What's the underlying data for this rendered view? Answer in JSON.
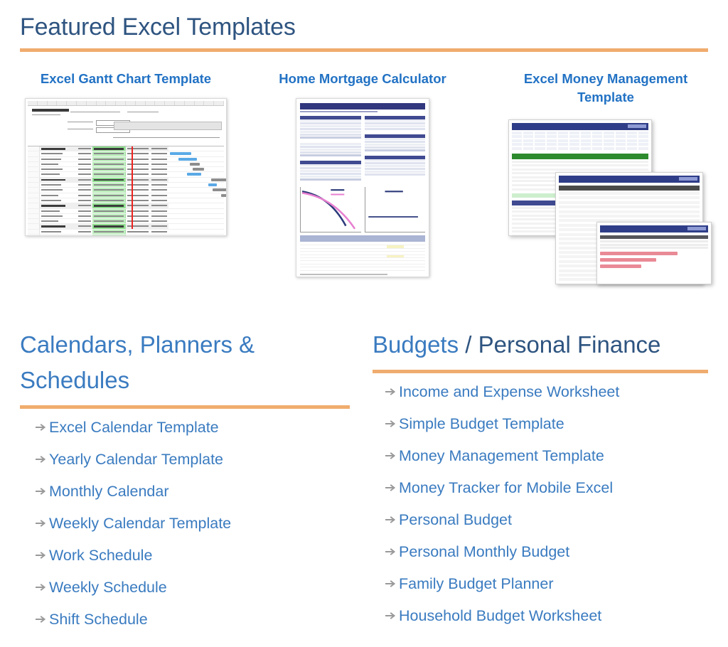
{
  "featured": {
    "title": "Featured Excel Templates",
    "accent_color": "#f0ac6e",
    "title_color": "#2e5480",
    "link_color": "#3a7bc0",
    "cards": [
      {
        "title": "Excel Gantt Chart Template",
        "thumb": "excel-gantt-chart-thumbnail"
      },
      {
        "title": "Home Mortgage Calculator",
        "thumb": "home-mortgage-calculator-thumbnail"
      },
      {
        "title": "Excel Money Management Template",
        "thumb": "money-management-thumbnail"
      }
    ]
  },
  "columns": [
    {
      "heading_parts": [
        {
          "text": "Calendars, Planners &",
          "style": "link"
        },
        {
          "text": "Schedules",
          "style": "link"
        }
      ],
      "heading_plain": "Calendars, Planners & Schedules",
      "items": [
        "Excel Calendar Template",
        "Yearly Calendar Template",
        "Monthly Calendar",
        "Weekly Calendar Template",
        "Work Schedule",
        "Weekly Schedule",
        "Shift Schedule"
      ]
    },
    {
      "heading_parts": [
        {
          "text": "Budgets",
          "style": "link"
        },
        {
          "text": " / Personal Finance",
          "style": "dark"
        }
      ],
      "heading_plain": "Budgets / Personal Finance",
      "items": [
        "Income and Expense Worksheet",
        "Simple Budget Template",
        "Money Management Template",
        "Money Tracker for Mobile Excel",
        "Personal Budget",
        "Personal Monthly Budget",
        "Family Budget Planner",
        "Household Budget Worksheet"
      ]
    }
  ],
  "icons": {
    "bullet": "arrow-right-icon"
  }
}
